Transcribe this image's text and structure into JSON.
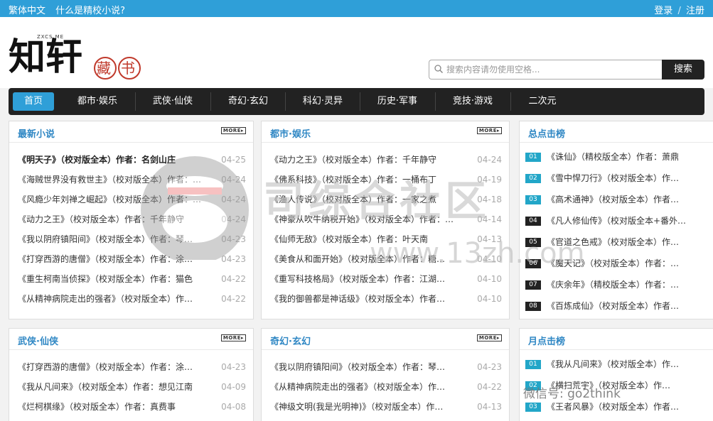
{
  "topbar": {
    "links": [
      "繁体中文",
      "什么是精校小说?"
    ],
    "login": "登录",
    "divider": "/",
    "register": "注册"
  },
  "logo": {
    "text": "知轩藏书",
    "tagline": "ZXCS.ME"
  },
  "search": {
    "placeholder": "搜索内容请勿使用空格...",
    "button": "搜索"
  },
  "nav": [
    "首页",
    "都市·娱乐",
    "武侠·仙侠",
    "奇幻·玄幻",
    "科幻·灵异",
    "历史·军事",
    "竞技·游戏",
    "二次元"
  ],
  "more_label": "MORE▸",
  "panels": {
    "latest": {
      "title": "最新小说",
      "rows": [
        {
          "t": "《明天子》（校对版全本）作者：名剑山庄",
          "d": "04-25"
        },
        {
          "t": "《海贼世界没有救世主》（校对版全本）作者：…",
          "d": "04-24"
        },
        {
          "t": "《风瘾少年刘禅之崛起》（校对版全本）作者：…",
          "d": "04-24"
        },
        {
          "t": "《动力之王》（校对版全本）作者：千年静守",
          "d": "04-24"
        },
        {
          "t": "《我以阴府镇阳间》（校对版全本）作者：琴…",
          "d": "04-23"
        },
        {
          "t": "《打穿西游的唐僧》（校对版全本）作者：涂…",
          "d": "04-23"
        },
        {
          "t": "《重生柯南当侦探》（校对版全本）作者：猫色",
          "d": "04-22"
        },
        {
          "t": "《从精神病院走出的强者》（校对版全本）作…",
          "d": "04-22"
        }
      ]
    },
    "urban": {
      "title": "都市·娱乐",
      "rows": [
        {
          "t": "《动力之王》（校对版全本）作者：千年静守",
          "d": "04-24"
        },
        {
          "t": "《佛系科技》（校对版全本）作者：一桶布丁",
          "d": "04-19"
        },
        {
          "t": "《渔人传说》（校对版全本）作者：一家之煮",
          "d": "04-18"
        },
        {
          "t": "《神豪从吹牛纳税开始》（校对版全本）作者：…",
          "d": "04-14"
        },
        {
          "t": "《仙师无敌》（校对版全本）作者：叶天南",
          "d": "04-13"
        },
        {
          "t": "《美食从和面开始》（校对版全本）作者：糖…",
          "d": "04-10"
        },
        {
          "t": "《重写科技格局》（校对版全本）作者：江湖…",
          "d": "04-10"
        },
        {
          "t": "《我的御兽都是神话级》（校对版全本）作者…",
          "d": "04-10"
        }
      ]
    },
    "total": {
      "title": "总点击榜",
      "rows": [
        {
          "n": "01",
          "t": "《诛仙》（精校版全本）作者：萧鼎"
        },
        {
          "n": "02",
          "t": "《雪中悍刀行》（校对版全本）作…"
        },
        {
          "n": "03",
          "t": "《高术通神》（校对版全本）作者…"
        },
        {
          "n": "04",
          "t": "《凡人修仙传》（校对版全本+番外…"
        },
        {
          "n": "05",
          "t": "《官道之色戒》（校对版全本）作…"
        },
        {
          "n": "06",
          "t": "《魔天记》（校对版全本）作者：…"
        },
        {
          "n": "07",
          "t": "《庆余年》（精校版全本）作者：…"
        },
        {
          "n": "08",
          "t": "《百炼成仙》（校对版全本）作者…"
        }
      ]
    },
    "wuxia": {
      "title": "武侠·仙侠",
      "rows": [
        {
          "t": "《打穿西游的唐僧》（校对版全本）作者：涂…",
          "d": "04-23"
        },
        {
          "t": "《我从凡间来》（校对版全本）作者：想见江南",
          "d": "04-09"
        },
        {
          "t": "《烂柯棋缘》（校对版全本）作者：真费事",
          "d": "04-08"
        }
      ]
    },
    "fantasy": {
      "title": "奇幻·玄幻",
      "rows": [
        {
          "t": "《我以阴府镇阳间》（校对版全本）作者：琴…",
          "d": "04-23"
        },
        {
          "t": "《从精神病院走出的强者》（校对版全本）作…",
          "d": "04-22"
        },
        {
          "t": "《神级文明(我是光明神)》（校对版全本）作…",
          "d": "04-13"
        }
      ]
    },
    "monthly": {
      "title": "月点击榜",
      "rows": [
        {
          "n": "01",
          "t": "《我从凡间来》（校对版全本）作…"
        },
        {
          "n": "02",
          "t": "《横扫荒宇》（校对版全本）作…"
        },
        {
          "n": "03",
          "t": "《王者风暴》（校对版全本）作者…"
        }
      ]
    }
  },
  "watermark": {
    "text": "司综合社区",
    "url": "www.13zh.com",
    "wechat": "微信号: go2think"
  }
}
